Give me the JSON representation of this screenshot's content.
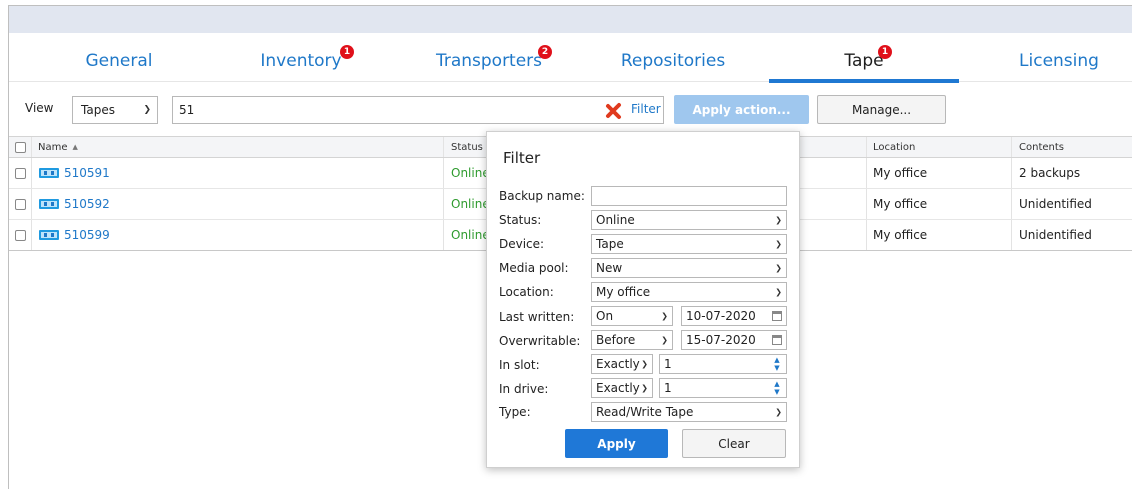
{
  "tabs": [
    {
      "label": "General",
      "badge": ""
    },
    {
      "label": "Inventory",
      "badge": "1"
    },
    {
      "label": "Transporters",
      "badge": "2"
    },
    {
      "label": "Repositories",
      "badge": ""
    },
    {
      "label": "Tape",
      "badge": "1"
    },
    {
      "label": "Licensing",
      "badge": ""
    }
  ],
  "active_tab": "Tape",
  "toolbar": {
    "view_label": "View",
    "view_value": "Tapes",
    "search_value": "51",
    "filter_label": "Filter",
    "apply_action_label": "Apply action...",
    "manage_label": "Manage..."
  },
  "grid": {
    "columns": {
      "name": "Name",
      "status": "Status",
      "location": "Location",
      "contents": "Contents"
    },
    "sort_indicator": "▲",
    "rows": [
      {
        "name": "510591",
        "status": "Online",
        "location": "My office",
        "contents": "2 backups"
      },
      {
        "name": "510592",
        "status": "Online",
        "location": "My office",
        "contents": "Unidentified"
      },
      {
        "name": "510599",
        "status": "Online",
        "location": "My office",
        "contents": "Unidentified"
      }
    ]
  },
  "filter_popup": {
    "title": "Filter",
    "labels": {
      "backup_name": "Backup name:",
      "status": "Status:",
      "device": "Device:",
      "media_pool": "Media pool:",
      "location": "Location:",
      "last_written": "Last written:",
      "overwritable": "Overwritable:",
      "in_slot": "In slot:",
      "in_drive": "In drive:",
      "type": "Type:"
    },
    "values": {
      "backup_name": "",
      "status": "Online",
      "device": "Tape",
      "media_pool": "New",
      "location": "My office",
      "last_written_op": "On",
      "last_written_date": "10-07-2020",
      "overwritable_op": "Before",
      "overwritable_date": "15-07-2020",
      "in_slot_op": "Exactly",
      "in_slot_value": "1",
      "in_drive_op": "Exactly",
      "in_drive_value": "1",
      "type": "Read/Write Tape"
    },
    "apply_label": "Apply",
    "clear_label": "Clear"
  },
  "colors": {
    "accent": "#1f78d7",
    "link": "#1f78c8",
    "badge": "#e0101a",
    "online": "#2f9b2f",
    "filter_x": "#e03a1e",
    "topbar": "#e1e6f0"
  }
}
